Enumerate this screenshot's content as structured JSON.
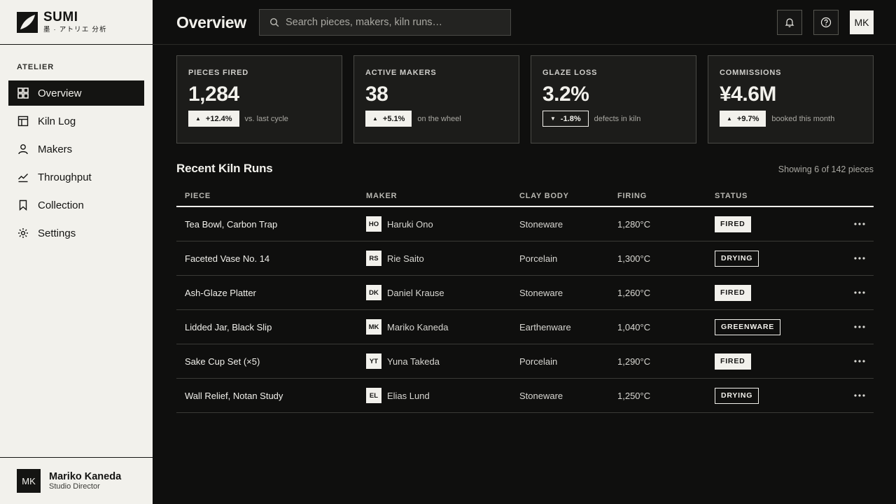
{
  "brand": {
    "name": "SUMI",
    "subtitle": "墨 · アトリエ 分析"
  },
  "sidebar": {
    "section_label": "ATELIER",
    "items": [
      {
        "label": "Overview",
        "icon": "grid-icon",
        "active": true
      },
      {
        "label": "Kiln Log",
        "icon": "layout-icon",
        "active": false
      },
      {
        "label": "Makers",
        "icon": "user-icon",
        "active": false
      },
      {
        "label": "Throughput",
        "icon": "chart-line-icon",
        "active": false
      },
      {
        "label": "Collection",
        "icon": "bookmark-icon",
        "active": false
      },
      {
        "label": "Settings",
        "icon": "gear-icon",
        "active": false
      }
    ],
    "user": {
      "initials": "MK",
      "name": "Mariko Kaneda",
      "role": "Studio Director"
    }
  },
  "header": {
    "title": "Overview",
    "search_placeholder": "Search pieces, makers, kiln runs…",
    "avatar_initials": "MK"
  },
  "kpis": [
    {
      "label": "PIECES FIRED",
      "value": "1,284",
      "delta": "+12.4%",
      "direction": "up",
      "note": "vs. last cycle"
    },
    {
      "label": "ACTIVE MAKERS",
      "value": "38",
      "delta": "+5.1%",
      "direction": "up",
      "note": "on the wheel"
    },
    {
      "label": "GLAZE LOSS",
      "value": "3.2%",
      "delta": "-1.8%",
      "direction": "down",
      "note": "defects in kiln"
    },
    {
      "label": "COMMISSIONS",
      "value": "¥4.6M",
      "delta": "+9.7%",
      "direction": "up",
      "note": "booked this month"
    }
  ],
  "table": {
    "title": "Recent Kiln Runs",
    "count_text": "Showing 6 of 142 pieces",
    "columns": [
      "PIECE",
      "MAKER",
      "CLAY BODY",
      "FIRING",
      "STATUS"
    ],
    "rows": [
      {
        "piece": "Tea Bowl, Carbon Trap",
        "maker_initials": "HO",
        "maker": "Haruki Ono",
        "clay": "Stoneware",
        "firing": "1,280°C",
        "status": "FIRED",
        "style": "solid"
      },
      {
        "piece": "Faceted Vase No. 14",
        "maker_initials": "RS",
        "maker": "Rie Saito",
        "clay": "Porcelain",
        "firing": "1,300°C",
        "status": "DRYING",
        "style": "outline"
      },
      {
        "piece": "Ash-Glaze Platter",
        "maker_initials": "DK",
        "maker": "Daniel Krause",
        "clay": "Stoneware",
        "firing": "1,260°C",
        "status": "FIRED",
        "style": "solid"
      },
      {
        "piece": "Lidded Jar, Black Slip",
        "maker_initials": "MK",
        "maker": "Mariko Kaneda",
        "clay": "Earthenware",
        "firing": "1,040°C",
        "status": "GREENWARE",
        "style": "outline"
      },
      {
        "piece": "Sake Cup Set (×5)",
        "maker_initials": "YT",
        "maker": "Yuna Takeda",
        "clay": "Porcelain",
        "firing": "1,290°C",
        "status": "FIRED",
        "style": "solid"
      },
      {
        "piece": "Wall Relief, Notan Study",
        "maker_initials": "EL",
        "maker": "Elias Lund",
        "clay": "Stoneware",
        "firing": "1,250°C",
        "status": "DRYING",
        "style": "outline"
      }
    ]
  },
  "colors": {
    "ink": "#141412",
    "paper": "#f2f1ec",
    "surface": "#1c1c1a",
    "border": "#4a4a46"
  }
}
